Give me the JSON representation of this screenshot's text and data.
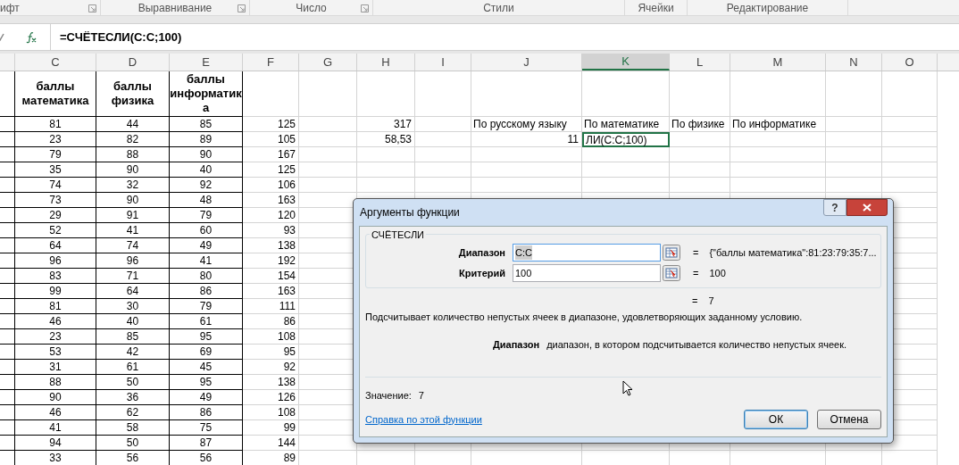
{
  "ribbon_groups": [
    {
      "label": "ифт",
      "launcher": true
    },
    {
      "label": "Выравнивание",
      "launcher": true
    },
    {
      "label": "Число",
      "launcher": true
    },
    {
      "label": "Стили",
      "launcher": false
    },
    {
      "label": "Ячейки",
      "launcher": false
    },
    {
      "label": "Редактирование",
      "launcher": false
    }
  ],
  "formula_bar": {
    "formula": "=СЧЁТЕСЛИ(C:C;100)"
  },
  "columns": [
    {
      "letter": "C",
      "selected": false
    },
    {
      "letter": "D",
      "selected": false
    },
    {
      "letter": "E",
      "selected": false
    },
    {
      "letter": "F",
      "selected": false
    },
    {
      "letter": "G",
      "selected": false
    },
    {
      "letter": "H",
      "selected": false
    },
    {
      "letter": "I",
      "selected": false
    },
    {
      "letter": "J",
      "selected": false
    },
    {
      "letter": "K",
      "selected": true
    },
    {
      "letter": "L",
      "selected": false
    },
    {
      "letter": "M",
      "selected": false
    },
    {
      "letter": "N",
      "selected": false
    },
    {
      "letter": "O",
      "selected": false
    }
  ],
  "header_row": {
    "c": "баллы математика",
    "d": "баллы физика",
    "e": "баллы информатика"
  },
  "rows": [
    {
      "c": "81",
      "d": "44",
      "e": "85",
      "f": "125",
      "h": {
        "value": "317",
        "kind": "number"
      },
      "j": {
        "value": "По русскому языку",
        "kind": "text"
      },
      "k": {
        "value": "По математике",
        "kind": "text"
      },
      "l": {
        "value": "По физике",
        "kind": "text"
      },
      "m": {
        "value": "По информатике",
        "kind": "text"
      }
    },
    {
      "c": "23",
      "d": "82",
      "e": "89",
      "f": "105",
      "h": {
        "value": "58,53",
        "kind": "number"
      },
      "j": {
        "value": "11",
        "kind": "number"
      },
      "k": {
        "value": "ЛИ(C:C;100)",
        "kind": "editing"
      }
    },
    {
      "c": "79",
      "d": "88",
      "e": "90",
      "f": "167"
    },
    {
      "c": "35",
      "d": "90",
      "e": "40",
      "f": "125"
    },
    {
      "c": "74",
      "d": "32",
      "e": "92",
      "f": "106"
    },
    {
      "c": "73",
      "d": "90",
      "e": "48",
      "f": "163"
    },
    {
      "c": "29",
      "d": "91",
      "e": "79",
      "f": "120"
    },
    {
      "c": "52",
      "d": "41",
      "e": "60",
      "f": "93"
    },
    {
      "c": "64",
      "d": "74",
      "e": "49",
      "f": "138"
    },
    {
      "c": "96",
      "d": "96",
      "e": "41",
      "f": "192"
    },
    {
      "c": "83",
      "d": "71",
      "e": "80",
      "f": "154"
    },
    {
      "c": "99",
      "d": "64",
      "e": "86",
      "f": "163"
    },
    {
      "c": "81",
      "d": "30",
      "e": "79",
      "f": "111"
    },
    {
      "c": "46",
      "d": "40",
      "e": "61",
      "f": "86"
    },
    {
      "c": "23",
      "d": "85",
      "e": "95",
      "f": "108"
    },
    {
      "c": "53",
      "d": "42",
      "e": "69",
      "f": "95"
    },
    {
      "c": "31",
      "d": "61",
      "e": "45",
      "f": "92"
    },
    {
      "c": "88",
      "d": "50",
      "e": "95",
      "f": "138"
    },
    {
      "c": "90",
      "d": "36",
      "e": "49",
      "f": "126"
    },
    {
      "c": "46",
      "d": "62",
      "e": "86",
      "f": "108"
    },
    {
      "c": "41",
      "d": "58",
      "e": "75",
      "f": "99"
    },
    {
      "c": "94",
      "d": "50",
      "e": "87",
      "f": "144"
    },
    {
      "c": "33",
      "d": "56",
      "e": "56",
      "f": "89"
    }
  ],
  "dialog": {
    "title": "Аргументы функции",
    "help_button": "?",
    "function_name": "СЧЁТЕСЛИ",
    "arguments": [
      {
        "label": "Диапазон",
        "value": "C:C",
        "sign": "=",
        "result": "{\"баллы математика\":81:23:79:35:7...",
        "focused": true
      },
      {
        "label": "Критерий",
        "value": "100",
        "sign": "=",
        "result": "100",
        "focused": false
      }
    ],
    "result_sign": "=",
    "result": "7",
    "description": "Подсчитывает количество непустых ячеек в диапазоне, удовлетворяющих заданному условию.",
    "argument_help": {
      "label": "Диапазон",
      "text": "диапазон, в котором подсчитывается количество непустых ячеек."
    },
    "value_label": "Значение:",
    "value": "7",
    "help_link": "Справка по этой функции",
    "buttons": [
      {
        "label": "ОК",
        "default": true
      },
      {
        "label": "Отмена",
        "default": false
      }
    ]
  }
}
